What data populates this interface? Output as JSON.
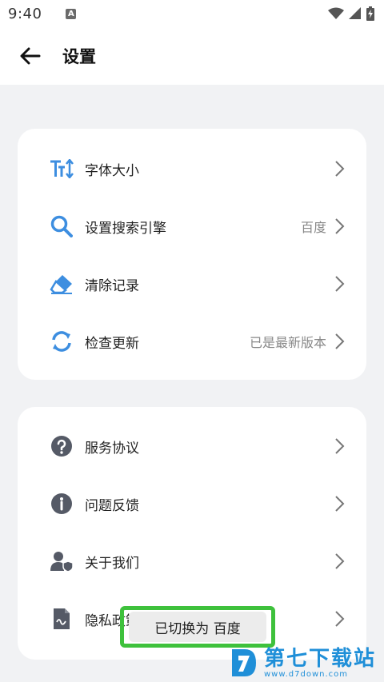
{
  "status_bar": {
    "time": "9:40",
    "notification_letter": "A"
  },
  "header": {
    "title": "设置"
  },
  "settings_group_1": [
    {
      "label": "字体大小",
      "value": "",
      "icon": "font-size-icon"
    },
    {
      "label": "设置搜索引擎",
      "value": "百度",
      "icon": "search-icon"
    },
    {
      "label": "清除记录",
      "value": "",
      "icon": "eraser-icon"
    },
    {
      "label": "检查更新",
      "value": "已是最新版本",
      "icon": "refresh-icon"
    }
  ],
  "settings_group_2": [
    {
      "label": "服务协议",
      "value": "",
      "icon": "question-icon"
    },
    {
      "label": "问题反馈",
      "value": "",
      "icon": "info-icon"
    },
    {
      "label": "关于我们",
      "value": "",
      "icon": "user-shield-icon"
    },
    {
      "label": "隐私政策",
      "value": "",
      "icon": "document-icon"
    }
  ],
  "toast": {
    "message": "已切换为 百度"
  },
  "watermark": {
    "brand": "第七下载站",
    "url": "www.d7down.com"
  },
  "colors": {
    "accent_blue": "#3d8ee0",
    "icon_gray": "#555a66",
    "toast_border": "#3ec13c"
  }
}
